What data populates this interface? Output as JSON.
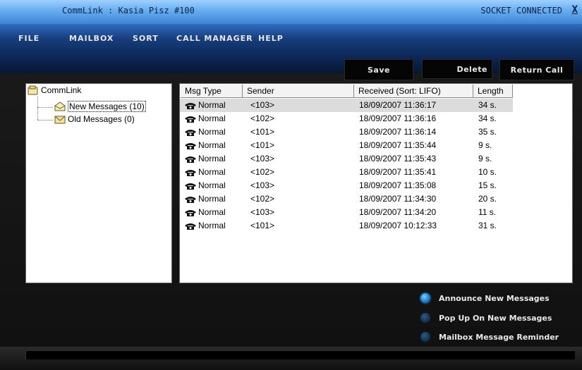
{
  "window": {
    "title": "CommLink : Kasia Pisz  #100",
    "status": "SOCKET CONNECTED",
    "close_label": "X"
  },
  "menu": [
    "FILE",
    "MAILBOX",
    "SORT",
    "CALL MANAGER",
    "HELP"
  ],
  "toolbar": {
    "save_label": "Save",
    "delete_label": "Delete",
    "return_call_label": "Return Call"
  },
  "tree": {
    "root": "CommLink",
    "items": [
      {
        "label": "New Messages (10)",
        "icon": "envelope-open-icon",
        "selected": true
      },
      {
        "label": "Old Messages (0)",
        "icon": "envelope-closed-icon",
        "selected": false
      }
    ]
  },
  "list": {
    "columns": [
      "Msg Type",
      "Sender",
      "Received (Sort: LIFO)",
      "Length"
    ],
    "rows": [
      {
        "type": "Normal",
        "sender": "<103>",
        "received": "18/09/2007 11:36:17",
        "length": "34 s."
      },
      {
        "type": "Normal",
        "sender": "<102>",
        "received": "18/09/2007 11:36:16",
        "length": "34 s."
      },
      {
        "type": "Normal",
        "sender": "<101>",
        "received": "18/09/2007 11:36:14",
        "length": "35 s."
      },
      {
        "type": "Normal",
        "sender": "<101>",
        "received": "18/09/2007 11:35:44",
        "length": "9 s."
      },
      {
        "type": "Normal",
        "sender": "<103>",
        "received": "18/09/2007 11:35:43",
        "length": "9 s."
      },
      {
        "type": "Normal",
        "sender": "<102>",
        "received": "18/09/2007 11:35:41",
        "length": "10 s."
      },
      {
        "type": "Normal",
        "sender": "<103>",
        "received": "18/09/2007 11:35:08",
        "length": "15 s."
      },
      {
        "type": "Normal",
        "sender": "<102>",
        "received": "18/09/2007 11:34:30",
        "length": "20 s."
      },
      {
        "type": "Normal",
        "sender": "<103>",
        "received": "18/09/2007 11:34:20",
        "length": "11 s."
      },
      {
        "type": "Normal",
        "sender": "<101>",
        "received": "18/09/2007 10:12:33",
        "length": "31 s."
      }
    ],
    "selected_row": 0
  },
  "options": [
    {
      "label": "Announce New Messages",
      "on": true
    },
    {
      "label": "Pop Up On New Messages",
      "on": false
    },
    {
      "label": "Mailbox Message Reminder",
      "on": false
    }
  ],
  "colors": {
    "title_gradient_top": "#9fd0ff",
    "menubar_blue": "#173e7c",
    "radio_active": "#2a8fd8"
  }
}
